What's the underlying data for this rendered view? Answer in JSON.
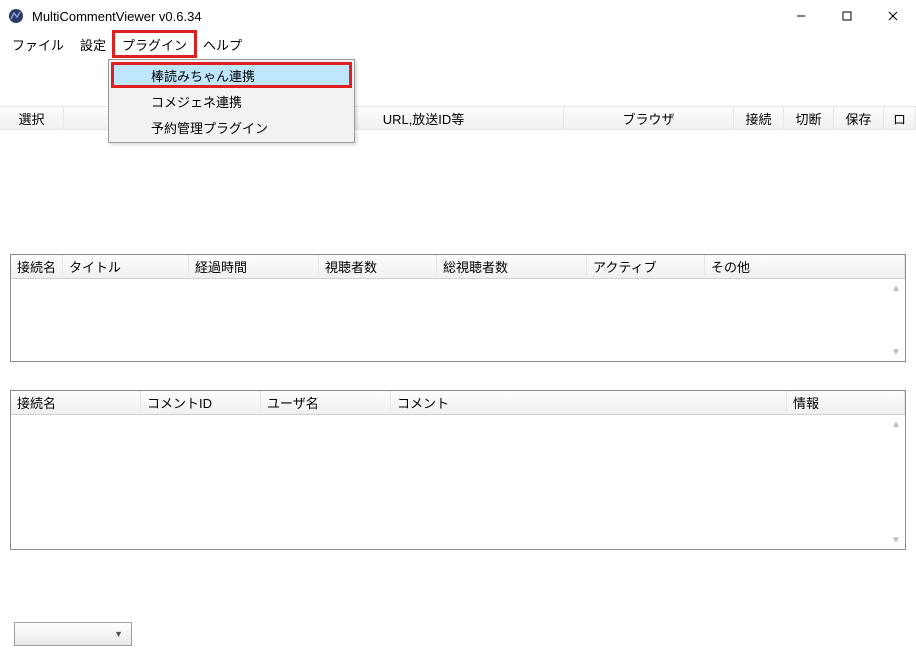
{
  "titlebar": {
    "title": "MultiCommentViewer v0.6.34"
  },
  "menubar": {
    "file": "ファイル",
    "settings": "設定",
    "plugin": "プラグイン",
    "help": "ヘルプ"
  },
  "dropdown": {
    "item0": "棒読みちゃん連携",
    "item1": "コメジェネ連携",
    "item2": "予約管理プラグイン"
  },
  "toolbar": {
    "select": "選択",
    "url": "URL,放送ID等",
    "browser": "ブラウザ",
    "connect": "接続",
    "disconnect": "切断",
    "save": "保存",
    "extra": "ロ"
  },
  "grid1": {
    "h0": "接続名",
    "h1": "タイトル",
    "h2": "経過時間",
    "h3": "視聴者数",
    "h4": "総視聴者数",
    "h5": "アクティブ",
    "h6": "その他"
  },
  "grid2": {
    "h0": "接続名",
    "h1": "コメントID",
    "h2": "ユーザ名",
    "h3": "コメント",
    "h4": "情報"
  }
}
